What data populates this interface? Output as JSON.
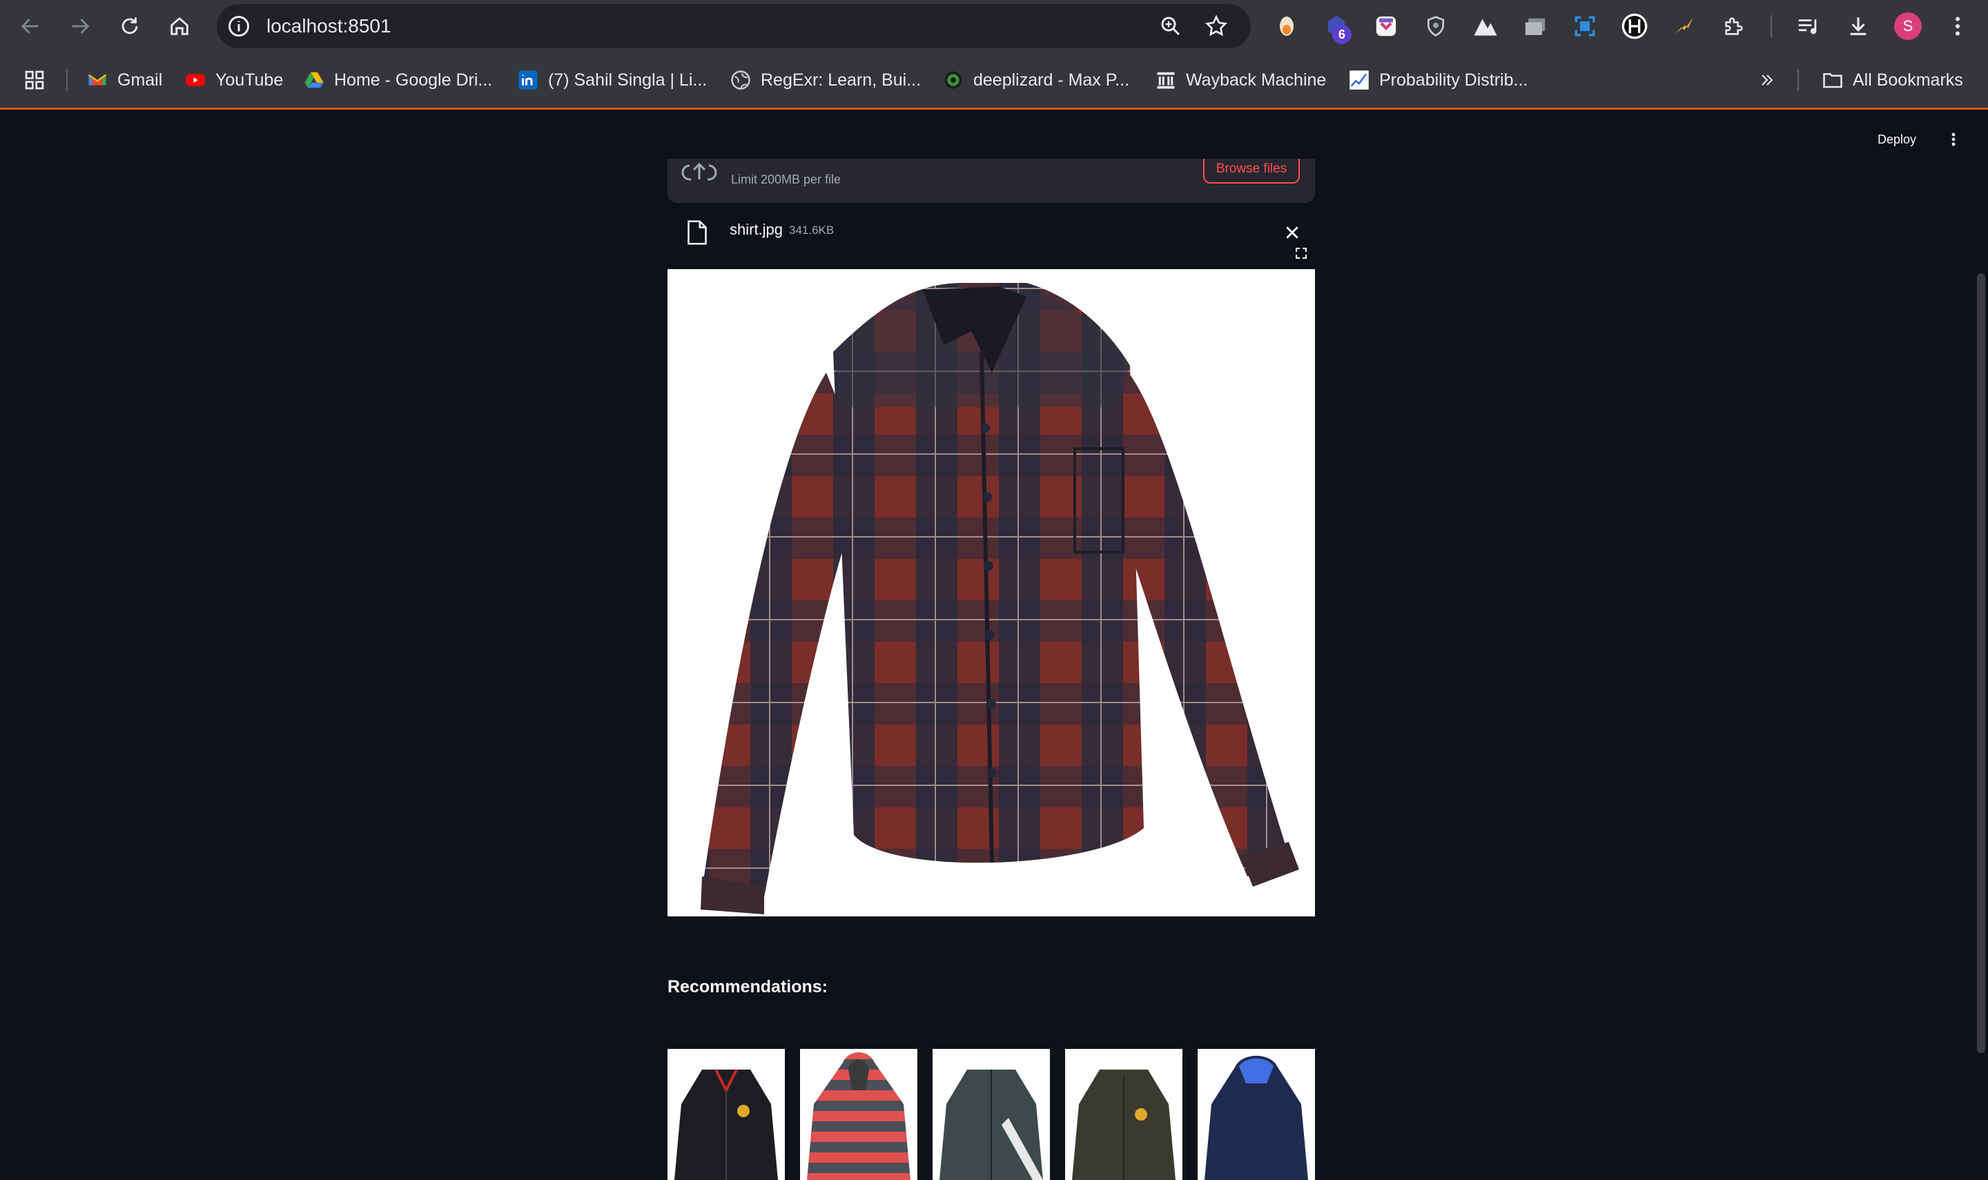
{
  "browser": {
    "url": "localhost:8501",
    "extension_badge": "6",
    "profile_initial": "S",
    "bookmarks": [
      {
        "label": "Gmail",
        "icon": "gmail-icon"
      },
      {
        "label": "YouTube",
        "icon": "youtube-icon"
      },
      {
        "label": "Home - Google Dri...",
        "icon": "google-drive-icon"
      },
      {
        "label": "(7) Sahil Singla | Li...",
        "icon": "linkedin-icon"
      },
      {
        "label": "RegExr: Learn, Bui...",
        "icon": "globe-icon"
      },
      {
        "label": "deeplizard - Max P...",
        "icon": "deeplizard-icon"
      },
      {
        "label": "Wayback Machine",
        "icon": "wayback-icon"
      },
      {
        "label": "Probability Distrib...",
        "icon": "chart-icon"
      }
    ],
    "all_bookmarks": "All Bookmarks"
  },
  "app": {
    "deploy_label": "Deploy",
    "uploader": {
      "limit": "Limit 200MB per file",
      "browse_label": "Browse files"
    },
    "file": {
      "name": "shirt.jpg",
      "size": "341.6KB"
    },
    "recommendations_title": "Recommendations:"
  },
  "colors": {
    "app_background": "#0e1117",
    "accent": "#ff4b4b",
    "chrome": "#35363a"
  }
}
